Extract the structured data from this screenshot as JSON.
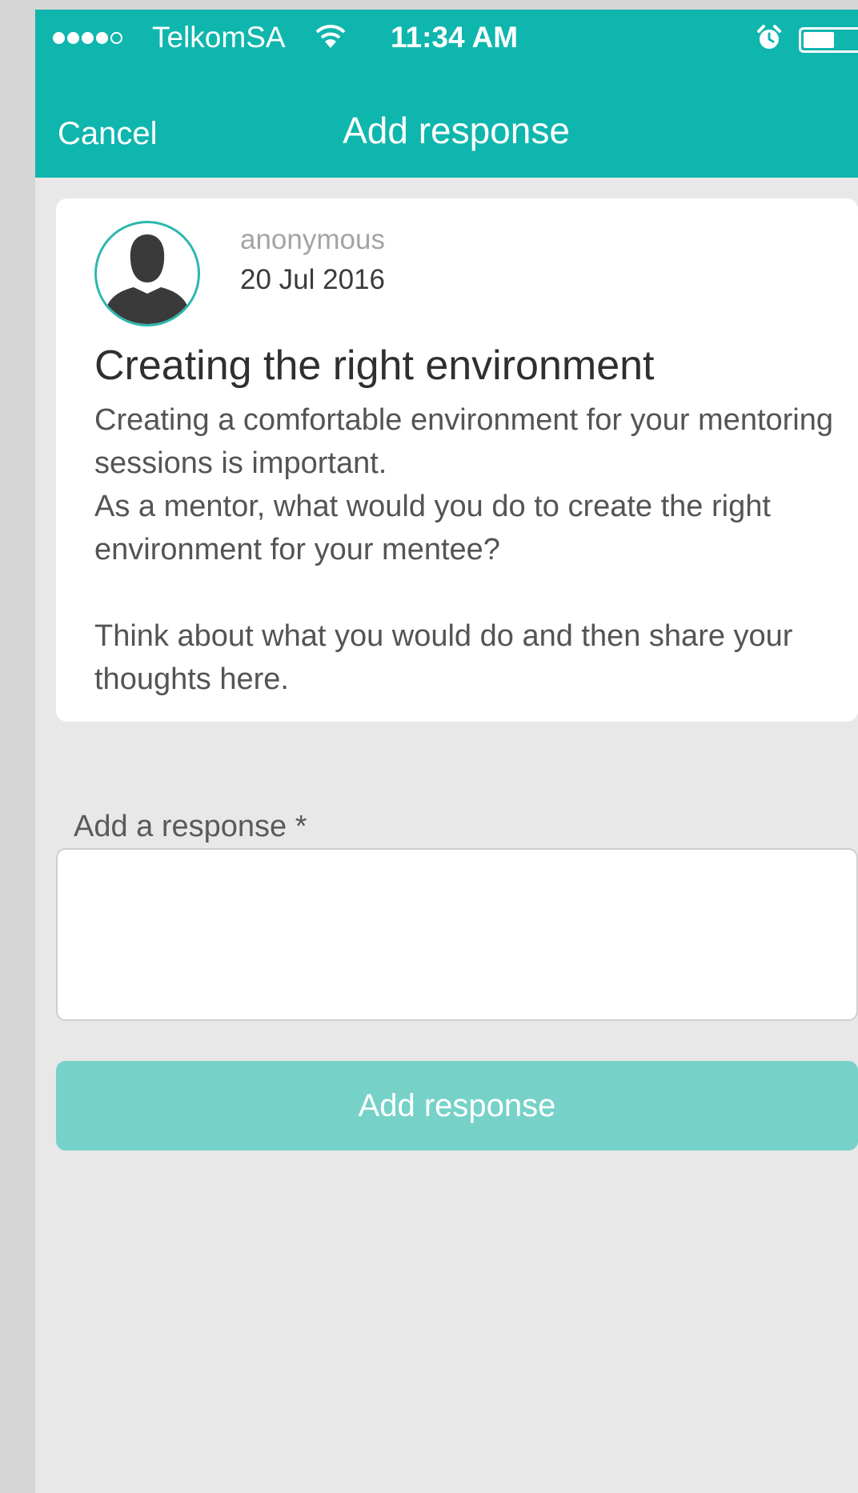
{
  "status_bar": {
    "carrier": "TelkomSA",
    "time": "11:34 AM",
    "signal_bars": 4,
    "signal_max": 5,
    "wifi_icon": "wifi-icon",
    "alarm_icon": "alarm-icon",
    "battery_icon": "battery-icon"
  },
  "nav": {
    "cancel_label": "Cancel",
    "title": "Add response"
  },
  "post": {
    "author": "anonymous",
    "date": "20 Jul 2016",
    "title": "Creating the right environment",
    "body_paragraph_1": "Creating a comfortable environment for your mentoring sessions is important.",
    "body_paragraph_2": "As a mentor, what would you do to create the right environment for your mentee?",
    "body_paragraph_3": "Think about what you would do and then share your thoughts here.",
    "avatar_icon": "user-silhouette-icon"
  },
  "form": {
    "label": "Add a response *",
    "input_value": "",
    "submit_label": "Add response"
  },
  "colors": {
    "header": "#0fb6ad",
    "accent": "#2db7ae",
    "button_disabled": "#76d2c9",
    "background": "#e8e8e8"
  }
}
